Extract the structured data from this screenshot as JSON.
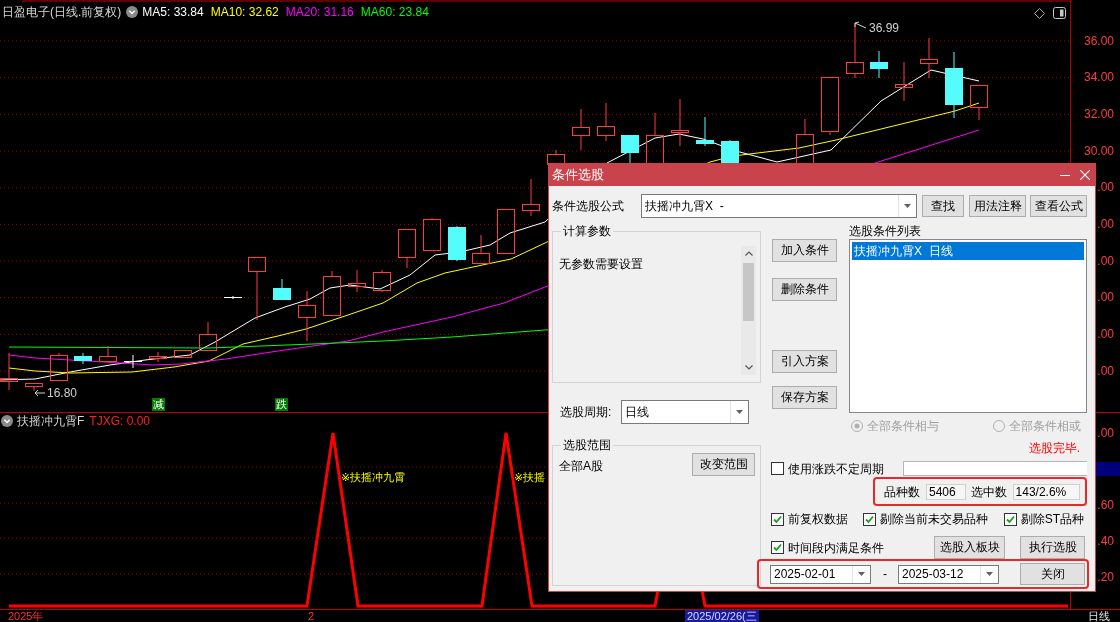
{
  "chart_header": {
    "title": "日盈电子(日线.前复权)",
    "moving_averages": [
      {
        "label": "MA5: 33.84",
        "color": "#ffffff"
      },
      {
        "label": "MA10: 32.62",
        "color": "#ffff00"
      },
      {
        "label": "MA20: 31.16",
        "color": "#ff00ff"
      },
      {
        "label": "MA60: 23.84",
        "color": "#00ff00"
      }
    ]
  },
  "price_chart": {
    "high_label": "36.99",
    "low_label": "16.80",
    "signals": [
      "减",
      "跌"
    ],
    "axis_labels": [
      "36.00",
      "34.00",
      "32.00",
      "30.00",
      ".00",
      ".00",
      ".00",
      ".00",
      ".00",
      ".00"
    ]
  },
  "indicator": {
    "name": "扶摇冲九霄F",
    "reading": "TJXG: 0.00",
    "signal_labels": [
      "※扶摇冲九霄",
      "※扶摇"
    ],
    "axis": [
      {
        "kind": "label",
        "text": ".00"
      },
      {
        "kind": "marker"
      },
      {
        "kind": "label",
        "text": ".60"
      },
      {
        "kind": "label",
        "text": ".40"
      },
      {
        "kind": "label",
        "text": ".20"
      }
    ]
  },
  "time_axis": [
    {
      "kind": "date",
      "text": "2025年"
    },
    {
      "kind": "date",
      "text": "2"
    },
    {
      "kind": "cursor",
      "text": "2025/02/26(三"
    },
    {
      "kind": "period",
      "text": "日线"
    }
  ],
  "dialog": {
    "title": "条件选股",
    "formula": {
      "label": "条件选股公式",
      "value": "扶摇冲九霄X  -"
    },
    "formula_buttons": [
      "查找",
      "用法注释",
      "查看公式"
    ],
    "params": {
      "title": "计算参数",
      "text": "无参数需要设置"
    },
    "period": {
      "label": "选股周期:",
      "value": "日线"
    },
    "scope": {
      "title": "选股范围",
      "text": "全部A股",
      "button": "改变范围"
    },
    "condition_buttons": [
      "加入条件",
      "删除条件",
      "引入方案",
      "保存方案"
    ],
    "condition_list": {
      "title": "选股条件列表",
      "items": [
        {
          "text": "扶摇冲九霄X  日线",
          "selected": true
        }
      ]
    },
    "logic": [
      {
        "label": "全部条件相与",
        "selected": true,
        "disabled": true
      },
      {
        "label": "全部条件相或",
        "selected": false,
        "disabled": true
      }
    ],
    "status": "选股完毕.",
    "variable_period": {
      "label": "使用涨跌不定周期",
      "checked": false
    },
    "counts": [
      {
        "label": "品种数",
        "value": "5406"
      },
      {
        "label": "选中数",
        "value": "143/2.6%"
      }
    ],
    "options": [
      {
        "label": "前复权数据",
        "checked": true
      },
      {
        "label": "剔除当前未交易品种",
        "checked": true
      },
      {
        "label": "剔除ST品种",
        "checked": true
      }
    ],
    "interval": {
      "label": "时间段内满足条件",
      "checked": true
    },
    "action_buttons": [
      "选股入板块",
      "执行选股"
    ],
    "date_range": {
      "start": "2025-02-01",
      "separator": "-",
      "end": "2025-03-12"
    },
    "close_button": "关闭"
  }
}
